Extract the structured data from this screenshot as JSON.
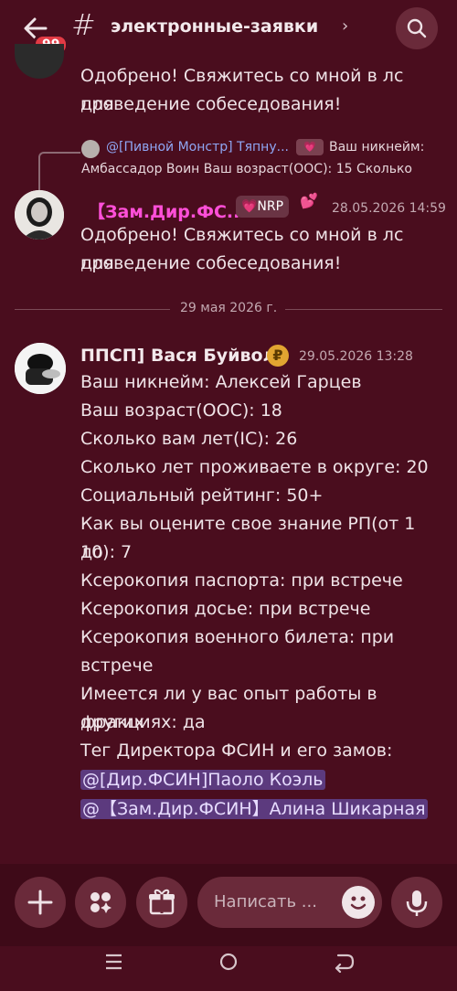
{
  "header": {
    "unread_badge": "99",
    "hash": "#",
    "channel_name": "электронные-заявки",
    "chevron": "›"
  },
  "messages": {
    "top_partial": {
      "line1": "Одобрено! Свяжитесь со мной в лс для",
      "line2": "проведение собеседования!"
    },
    "reply_preview": {
      "name": "@[Пивной Монстр] Тяпну...",
      "tag": "💗",
      "snippet_1": "Ваш никнейм:",
      "snippet_2": "Амбассадор Воин Ваш возраст(ООС):  15 Сколько"
    },
    "msg_pink": {
      "author": "【Зам.Дир.ФС...",
      "tag": "💗NRP",
      "hearts": "💕",
      "timestamp": "28.05.2026 14:59",
      "line1": "Одобрено! Свяжитесь со мной в лс для",
      "line2": "проведение собеседования!"
    },
    "date_divider": "29 мая 2026 г.",
    "msg_main": {
      "author": "ППСП] Вася Буйвол",
      "coin": "₽",
      "timestamp": "29.05.2026 13:28",
      "lines": [
        "Ваш никнейм: Алексей Гарцев",
        "Ваш возраст(ООС):  18",
        "Сколько вам лет(IC): 26",
        "Сколько лет проживаете в округе: 20",
        "Социальный рейтинг: 50+",
        "Как вы оцените свое знание РП(от 1 до",
        "10): 7",
        "Ксерокопия паспорта: при встрече",
        "Ксерокопия досье: при встрече",
        "Ксерокопия военного билета: при",
        "встрече",
        "Имеется ли у вас опыт работы в других",
        "фракциях: да",
        "Тег Директора ФСИН и его замов:"
      ],
      "mention_1": "@[Дир.ФСИН]Паоло Коэль",
      "mention_2": "@【Зам.Дир.ФСИН】Алина Шикарная"
    }
  },
  "composer": {
    "placeholder": "Написать ..."
  },
  "colors": {
    "background": "#4a0d1e",
    "mention_bg": "#5c3a7e",
    "pink_name": "#ff4fd8",
    "badge": "#e23b45"
  }
}
